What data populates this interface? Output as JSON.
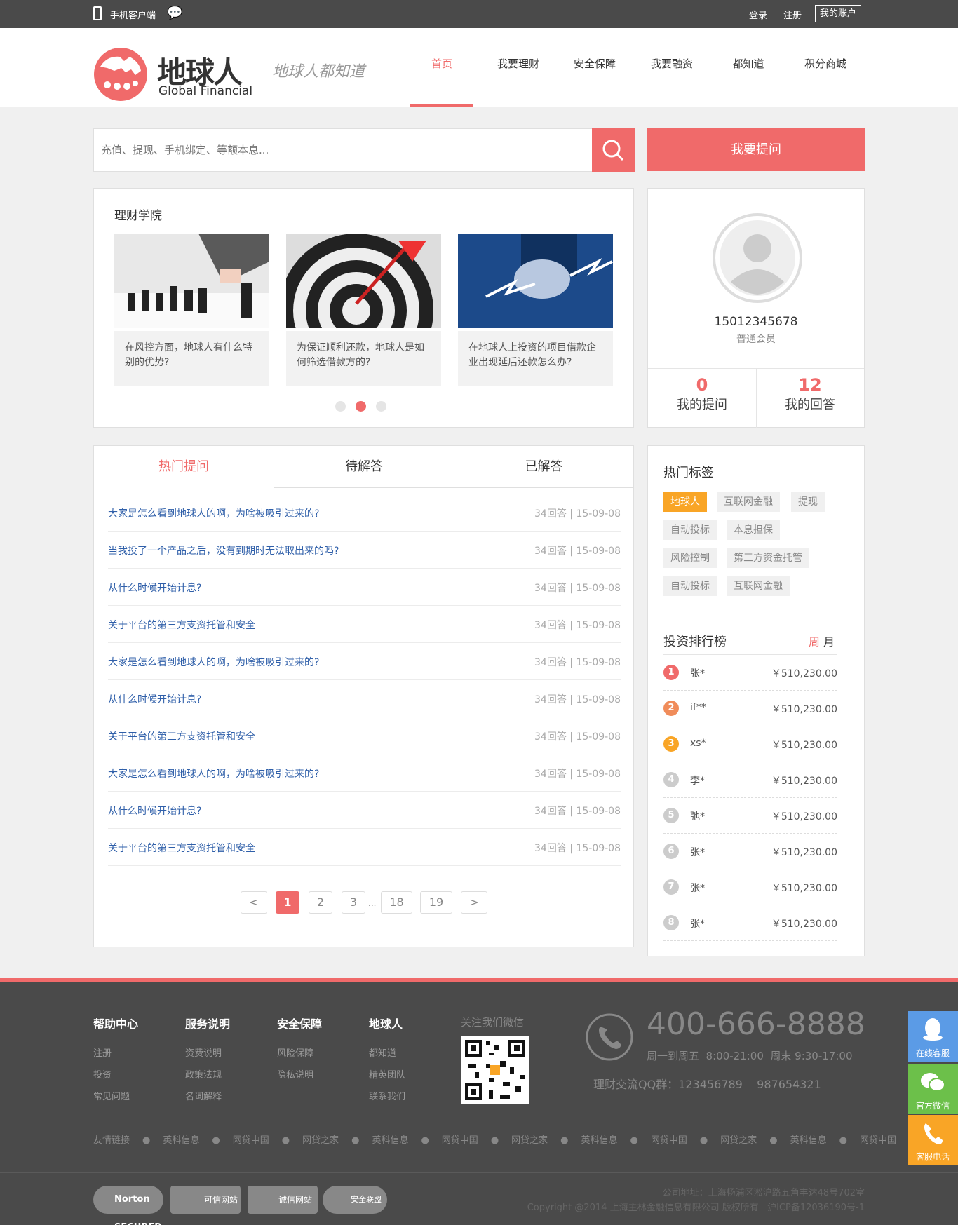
{
  "topbar": {
    "mobile": "手机客户端",
    "login": "登录",
    "register": "注册",
    "account": "我的账户"
  },
  "brand": {
    "name_cn": "地球人",
    "name_en": "Global Financial",
    "slogan": "地球人都知道"
  },
  "nav": [
    "首页",
    "我要理财",
    "安全保障",
    "我要融资",
    "都知道",
    "积分商城"
  ],
  "search": {
    "placeholder": "充值、提现、手机绑定、等额本息...",
    "ask": "我要提问"
  },
  "academy": {
    "title": "理财学院",
    "cards": [
      "在风控方面，地球人有什么特别的优势?",
      "为保证顺利还款，地球人是如何筛选借款方的?",
      "在地球人上投资的项目借款企业出现延后还款怎么办?"
    ]
  },
  "user": {
    "phone": "15012345678",
    "level": "普通会员",
    "questions": "0",
    "questions_label": "我的提问",
    "answers": "12",
    "answers_label": "我的回答"
  },
  "tabs": [
    "热门提问",
    "待解答",
    "已解答"
  ],
  "questions": [
    {
      "t": "大家是怎么看到地球人的啊，为啥被吸引过来的?",
      "m": "34回答 | 15-09-08"
    },
    {
      "t": "当我投了一个产品之后，没有到期时无法取出来的吗?",
      "m": "34回答 | 15-09-08"
    },
    {
      "t": "从什么时候开始计息?",
      "m": "34回答 | 15-09-08"
    },
    {
      "t": "关于平台的第三方支资托管和安全",
      "m": "34回答 | 15-09-08"
    },
    {
      "t": "大家是怎么看到地球人的啊，为啥被吸引过来的?",
      "m": "34回答 | 15-09-08"
    },
    {
      "t": "从什么时候开始计息?",
      "m": "34回答 | 15-09-08"
    },
    {
      "t": "关于平台的第三方支资托管和安全",
      "m": "34回答 | 15-09-08"
    },
    {
      "t": "大家是怎么看到地球人的啊，为啥被吸引过来的?",
      "m": "34回答 | 15-09-08"
    },
    {
      "t": "从什么时候开始计息?",
      "m": "34回答 | 15-09-08"
    },
    {
      "t": "关于平台的第三方支资托管和安全",
      "m": "34回答 | 15-09-08"
    }
  ],
  "pagination": {
    "prev": "<",
    "pages": [
      "1",
      "2",
      "3",
      "18",
      "19"
    ],
    "ellipsis": "...",
    "next": ">"
  },
  "tags": {
    "title": "热门标签",
    "items": [
      "地球人",
      "互联网金融",
      "提现",
      "自动投标",
      "本息担保",
      "风险控制",
      "第三方资金托管",
      "自动投标",
      "互联网金融"
    ]
  },
  "ranking": {
    "title": "投资排行榜",
    "week": "周",
    "month": "月",
    "rows": [
      {
        "n": "1",
        "name": "张*",
        "v": "￥510,230.00"
      },
      {
        "n": "2",
        "name": "if**",
        "v": "￥510,230.00"
      },
      {
        "n": "3",
        "name": "xs*",
        "v": "￥510,230.00"
      },
      {
        "n": "4",
        "name": "李*",
        "v": "￥510,230.00"
      },
      {
        "n": "5",
        "name": "弛*",
        "v": "￥510,230.00"
      },
      {
        "n": "6",
        "name": "张*",
        "v": "￥510,230.00"
      },
      {
        "n": "7",
        "name": "张*",
        "v": "￥510,230.00"
      },
      {
        "n": "8",
        "name": "张*",
        "v": "￥510,230.00"
      }
    ]
  },
  "footer": {
    "cols": [
      {
        "h": "帮助中心",
        "items": [
          "注册",
          "投资",
          "常见问题"
        ]
      },
      {
        "h": "服务说明",
        "items": [
          "资费说明",
          "政策法规",
          "名词解释"
        ]
      },
      {
        "h": "安全保障",
        "items": [
          "风险保障",
          "隐私说明"
        ]
      },
      {
        "h": "地球人",
        "items": [
          "都知道",
          "精英团队",
          "联系我们"
        ]
      }
    ],
    "wechat": "关注我们微信",
    "phone": "400-666-8888",
    "hours": "周一到周五  8:00-21:00  周末 9:30-17:00",
    "qq": "理财交流QQ群：123456789    987654321",
    "links": [
      "友情链接",
      "英科信息",
      "网贷中国",
      "网贷之家",
      "英科信息",
      "网贷中国",
      "网贷之家",
      "英科信息",
      "网贷中国",
      "网贷之家",
      "英科信息",
      "网贷中国"
    ],
    "address": "公司地址：上海杨浦区淞沪路五角丰达48号702室",
    "copyright": "Copyright @2014 上海主林金融信息有限公司 版权所有   沪ICP备12036190号-1",
    "badges": [
      "Norton SECURED",
      "可信网站",
      "诚信网站",
      "安全联盟"
    ]
  },
  "side": {
    "service": "在线客服",
    "wechat": "官方微信",
    "phone": "客服电话"
  },
  "colors": {
    "accent": "#f06a6a",
    "link": "#2f5fa9",
    "tag_hot": "#f9a526",
    "dark": "#4a4a4a"
  }
}
